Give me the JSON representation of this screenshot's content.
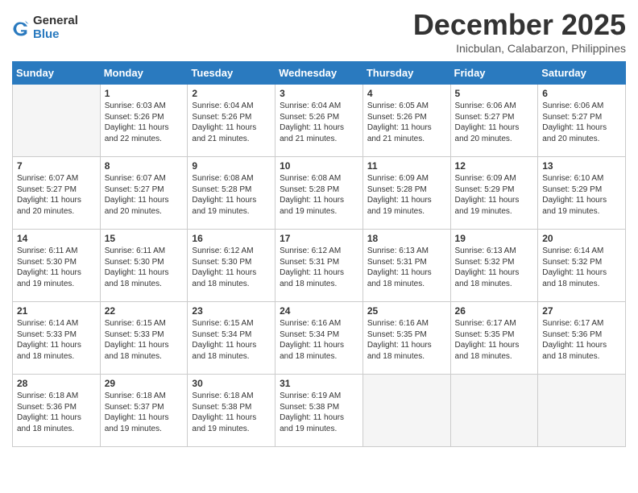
{
  "logo": {
    "general": "General",
    "blue": "Blue"
  },
  "title": "December 2025",
  "location": "Inicbulan, Calabarzon, Philippines",
  "weekdays": [
    "Sunday",
    "Monday",
    "Tuesday",
    "Wednesday",
    "Thursday",
    "Friday",
    "Saturday"
  ],
  "weeks": [
    [
      {
        "day": null
      },
      {
        "day": "1",
        "sunrise": "6:03 AM",
        "sunset": "5:26 PM",
        "daylight": "11 hours and 22 minutes."
      },
      {
        "day": "2",
        "sunrise": "6:04 AM",
        "sunset": "5:26 PM",
        "daylight": "11 hours and 21 minutes."
      },
      {
        "day": "3",
        "sunrise": "6:04 AM",
        "sunset": "5:26 PM",
        "daylight": "11 hours and 21 minutes."
      },
      {
        "day": "4",
        "sunrise": "6:05 AM",
        "sunset": "5:26 PM",
        "daylight": "11 hours and 21 minutes."
      },
      {
        "day": "5",
        "sunrise": "6:06 AM",
        "sunset": "5:27 PM",
        "daylight": "11 hours and 20 minutes."
      },
      {
        "day": "6",
        "sunrise": "6:06 AM",
        "sunset": "5:27 PM",
        "daylight": "11 hours and 20 minutes."
      }
    ],
    [
      {
        "day": "7",
        "sunrise": "6:07 AM",
        "sunset": "5:27 PM",
        "daylight": "11 hours and 20 minutes."
      },
      {
        "day": "8",
        "sunrise": "6:07 AM",
        "sunset": "5:27 PM",
        "daylight": "11 hours and 20 minutes."
      },
      {
        "day": "9",
        "sunrise": "6:08 AM",
        "sunset": "5:28 PM",
        "daylight": "11 hours and 19 minutes."
      },
      {
        "day": "10",
        "sunrise": "6:08 AM",
        "sunset": "5:28 PM",
        "daylight": "11 hours and 19 minutes."
      },
      {
        "day": "11",
        "sunrise": "6:09 AM",
        "sunset": "5:28 PM",
        "daylight": "11 hours and 19 minutes."
      },
      {
        "day": "12",
        "sunrise": "6:09 AM",
        "sunset": "5:29 PM",
        "daylight": "11 hours and 19 minutes."
      },
      {
        "day": "13",
        "sunrise": "6:10 AM",
        "sunset": "5:29 PM",
        "daylight": "11 hours and 19 minutes."
      }
    ],
    [
      {
        "day": "14",
        "sunrise": "6:11 AM",
        "sunset": "5:30 PM",
        "daylight": "11 hours and 19 minutes."
      },
      {
        "day": "15",
        "sunrise": "6:11 AM",
        "sunset": "5:30 PM",
        "daylight": "11 hours and 18 minutes."
      },
      {
        "day": "16",
        "sunrise": "6:12 AM",
        "sunset": "5:30 PM",
        "daylight": "11 hours and 18 minutes."
      },
      {
        "day": "17",
        "sunrise": "6:12 AM",
        "sunset": "5:31 PM",
        "daylight": "11 hours and 18 minutes."
      },
      {
        "day": "18",
        "sunrise": "6:13 AM",
        "sunset": "5:31 PM",
        "daylight": "11 hours and 18 minutes."
      },
      {
        "day": "19",
        "sunrise": "6:13 AM",
        "sunset": "5:32 PM",
        "daylight": "11 hours and 18 minutes."
      },
      {
        "day": "20",
        "sunrise": "6:14 AM",
        "sunset": "5:32 PM",
        "daylight": "11 hours and 18 minutes."
      }
    ],
    [
      {
        "day": "21",
        "sunrise": "6:14 AM",
        "sunset": "5:33 PM",
        "daylight": "11 hours and 18 minutes."
      },
      {
        "day": "22",
        "sunrise": "6:15 AM",
        "sunset": "5:33 PM",
        "daylight": "11 hours and 18 minutes."
      },
      {
        "day": "23",
        "sunrise": "6:15 AM",
        "sunset": "5:34 PM",
        "daylight": "11 hours and 18 minutes."
      },
      {
        "day": "24",
        "sunrise": "6:16 AM",
        "sunset": "5:34 PM",
        "daylight": "11 hours and 18 minutes."
      },
      {
        "day": "25",
        "sunrise": "6:16 AM",
        "sunset": "5:35 PM",
        "daylight": "11 hours and 18 minutes."
      },
      {
        "day": "26",
        "sunrise": "6:17 AM",
        "sunset": "5:35 PM",
        "daylight": "11 hours and 18 minutes."
      },
      {
        "day": "27",
        "sunrise": "6:17 AM",
        "sunset": "5:36 PM",
        "daylight": "11 hours and 18 minutes."
      }
    ],
    [
      {
        "day": "28",
        "sunrise": "6:18 AM",
        "sunset": "5:36 PM",
        "daylight": "11 hours and 18 minutes."
      },
      {
        "day": "29",
        "sunrise": "6:18 AM",
        "sunset": "5:37 PM",
        "daylight": "11 hours and 19 minutes."
      },
      {
        "day": "30",
        "sunrise": "6:18 AM",
        "sunset": "5:38 PM",
        "daylight": "11 hours and 19 minutes."
      },
      {
        "day": "31",
        "sunrise": "6:19 AM",
        "sunset": "5:38 PM",
        "daylight": "11 hours and 19 minutes."
      },
      {
        "day": null
      },
      {
        "day": null
      },
      {
        "day": null
      }
    ]
  ]
}
